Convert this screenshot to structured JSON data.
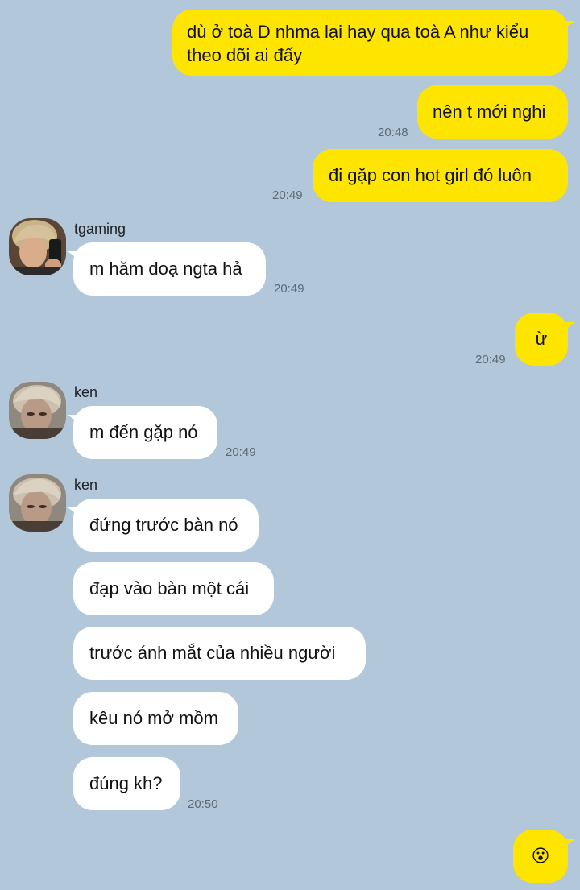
{
  "messages": {
    "m1": {
      "line1": "dù ở toà D nhma lại hay qua toà A như kiểu",
      "line2": "theo dõi ai đấy"
    },
    "m2": {
      "text": "nên t mới nghi",
      "time": "20:48"
    },
    "m3": {
      "text": "đi gặp con hot girl đó luôn",
      "time": "20:49"
    },
    "m4": {
      "sender": "tgaming",
      "text": "m hăm doạ ngta hả",
      "time": "20:49"
    },
    "m5": {
      "text": "ừ",
      "time": "20:49"
    },
    "m6": {
      "sender": "ken",
      "text": "m đến gặp nó",
      "time": "20:49"
    },
    "m7": {
      "sender": "ken",
      "texts": [
        "đứng trước bàn nó",
        "đạp vào bàn một cái",
        "trước ánh mắt của nhiều người",
        "kêu nó mở mồm",
        "đúng kh?"
      ],
      "time": "20:50"
    },
    "m8": {
      "emoji": "😮"
    }
  },
  "colors": {
    "background": "#b2c7d9",
    "my_bubble": "#fee500",
    "their_bubble": "#ffffff"
  },
  "icons": {
    "avatar_tgaming": "avatar-photo",
    "avatar_ken": "avatar-photo"
  }
}
